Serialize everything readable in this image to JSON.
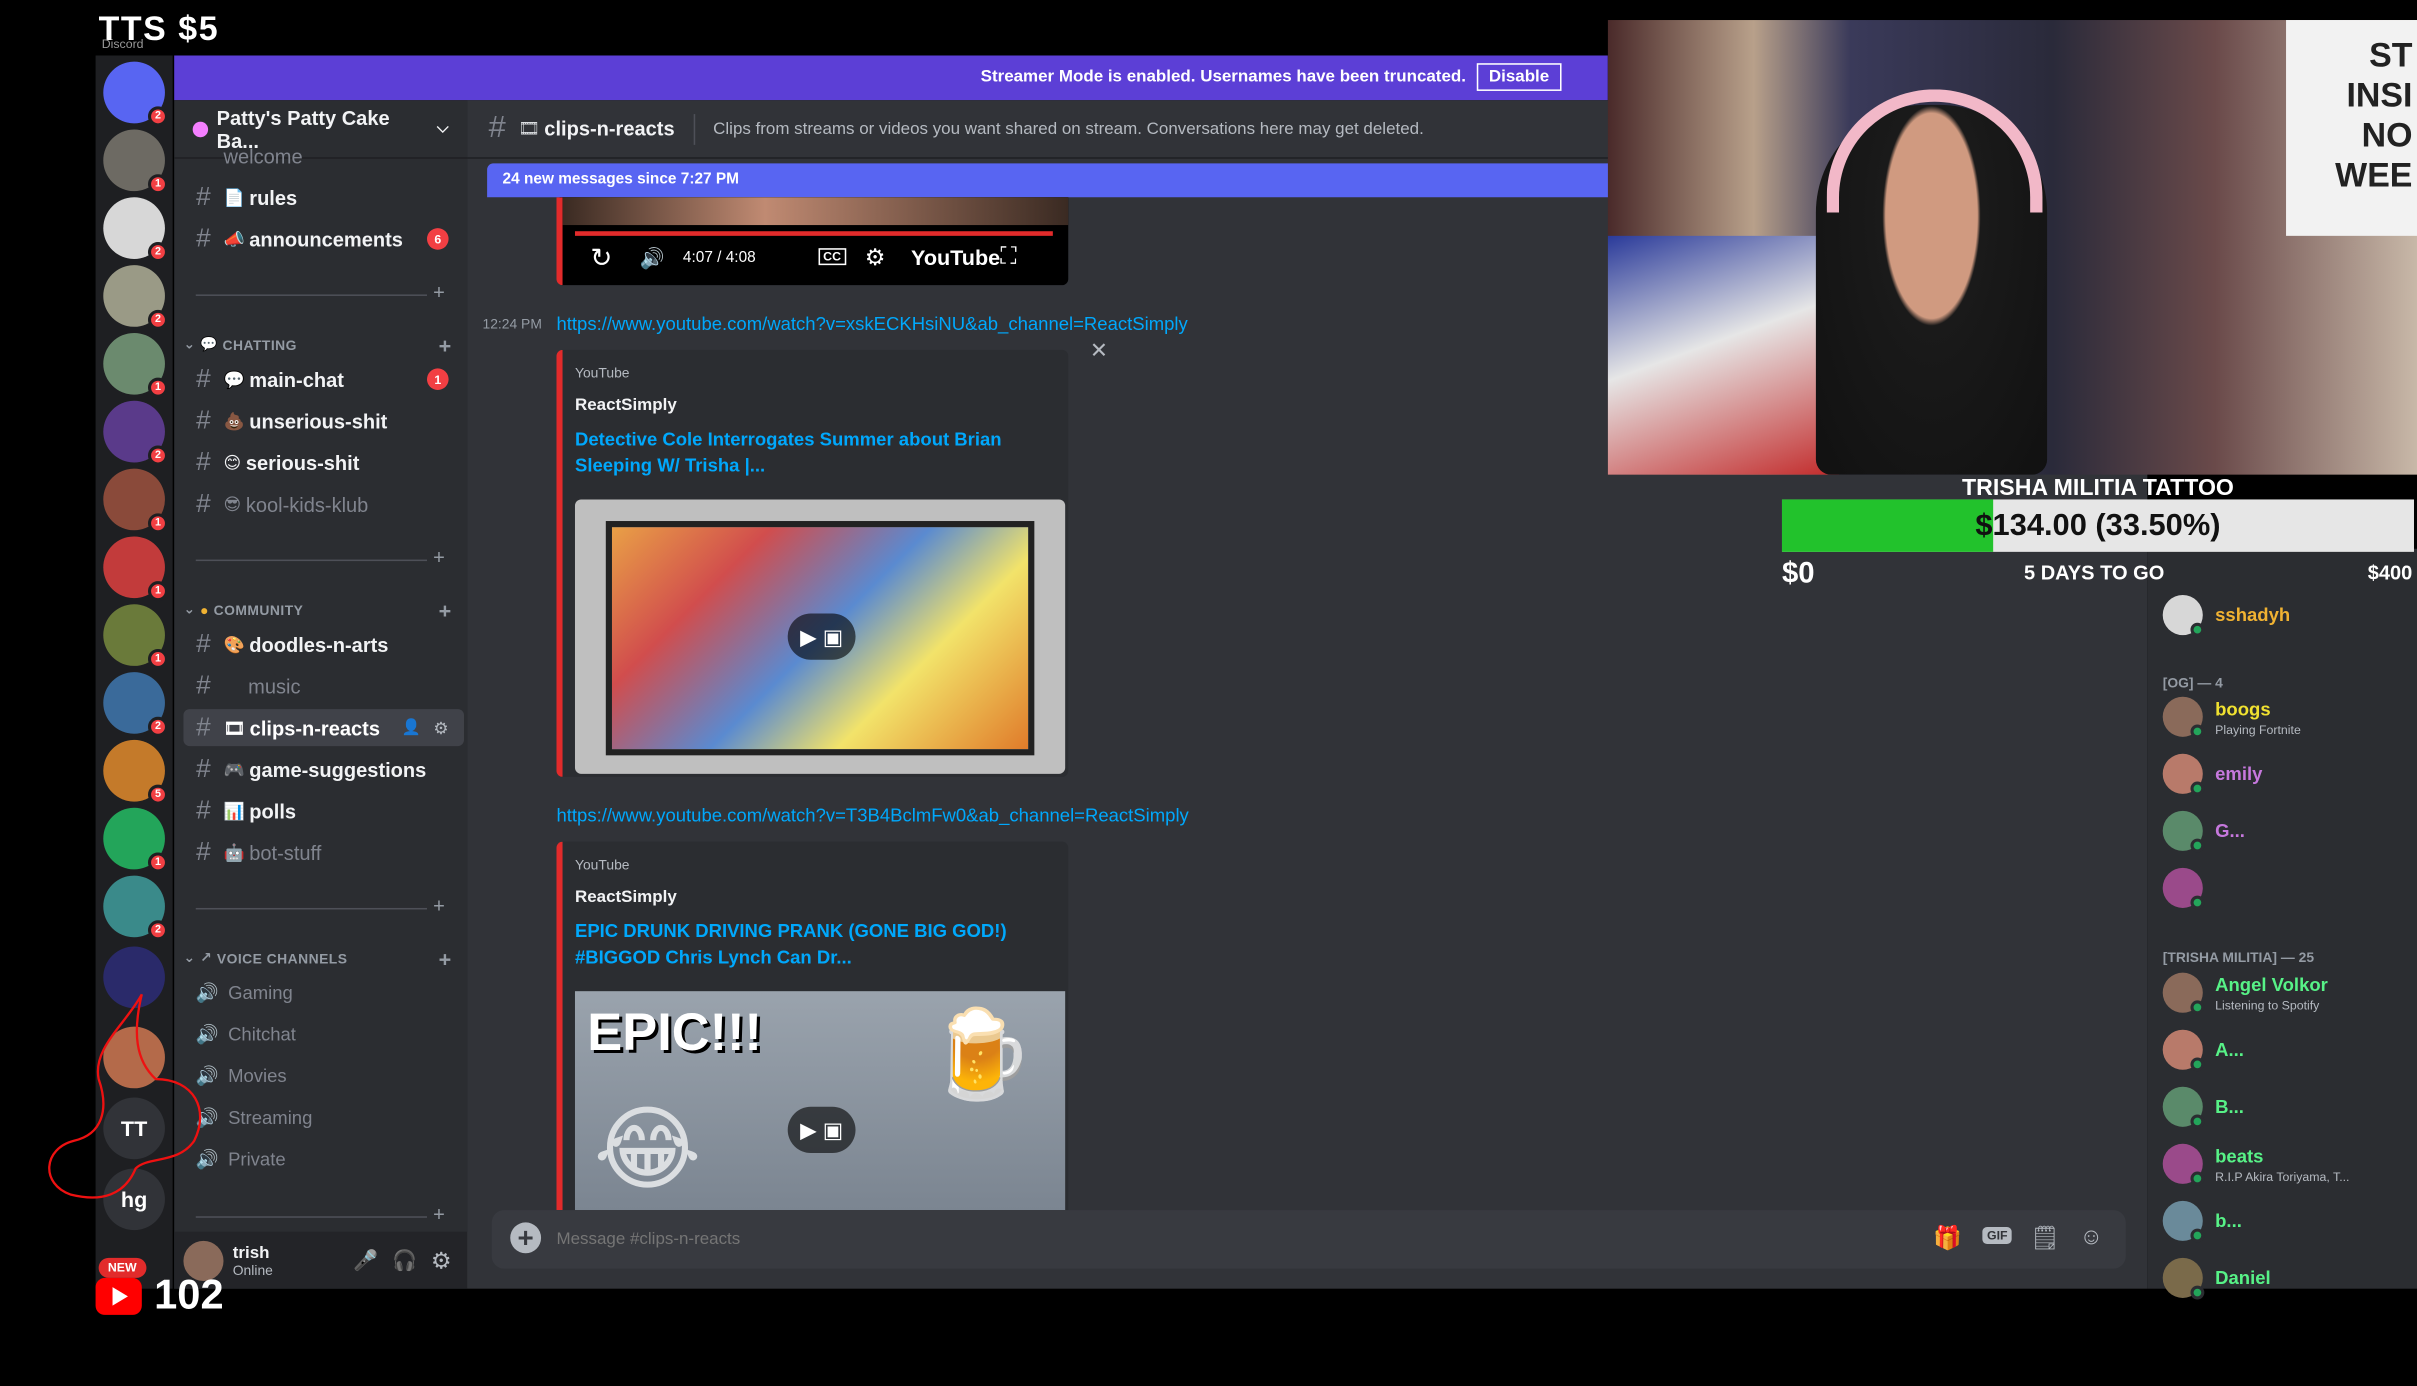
{
  "overlay": {
    "top_stat": "TTS $5",
    "discord_word": "Discord"
  },
  "banner": {
    "text": "Streamer Mode is enabled. Usernames have been truncated.",
    "button": "Disable"
  },
  "guild": {
    "name": "Patty's Patty Cake Ba..."
  },
  "rail": {
    "servers": [
      {
        "initials": "",
        "badge": "2",
        "color": "#5865f2"
      },
      {
        "initials": "",
        "badge": "1",
        "color": "#6d6a63"
      },
      {
        "initials": "",
        "badge": "2",
        "color": "#d7d7d7"
      },
      {
        "initials": "",
        "badge": "2",
        "color": "#9a9a86"
      },
      {
        "initials": "",
        "badge": "1",
        "color": "#6b8a6e"
      },
      {
        "initials": "",
        "badge": "2",
        "color": "#5a3a8a"
      },
      {
        "initials": "",
        "badge": "1",
        "color": "#8a4a3a"
      },
      {
        "initials": "",
        "badge": "1",
        "color": "#c23b3b"
      },
      {
        "initials": "",
        "badge": "1",
        "color": "#6a7a3a"
      },
      {
        "initials": "",
        "badge": "2",
        "color": "#3a6a9a"
      },
      {
        "initials": "",
        "badge": "5",
        "color": "#c47a2a"
      },
      {
        "initials": "",
        "badge": "1",
        "color": "#23a55a"
      },
      {
        "initials": "",
        "badge": "2",
        "color": "#3a8a8a"
      },
      {
        "initials": "",
        "badge": "",
        "color": "#2a2a6a"
      },
      {
        "initials": "",
        "badge": "",
        "color": "#b46a4a"
      },
      {
        "initials": "TT",
        "badge": "",
        "color": "#313338"
      },
      {
        "initials": "hg",
        "badge": "",
        "color": "#313338"
      }
    ]
  },
  "channels": {
    "top_partial": "welcome",
    "rules": "rules",
    "announcements": "announcements",
    "announcements_badge": "6",
    "cat_chatting": "CHATTING",
    "main_chat": "main-chat",
    "main_chat_badge": "1",
    "unserious": "unserious-shit",
    "serious": "serious-shit",
    "kool": "kool-kids-klub",
    "cat_community": "COMMUNITY",
    "doodles": "doodles-n-arts",
    "music": "music",
    "clips": "clips-n-reacts",
    "game": "game-suggestions",
    "polls": "polls",
    "bot": "bot-stuff",
    "cat_voice": "VOICE CHANNELS",
    "voice": [
      "Gaming",
      "Chitchat",
      "Movies",
      "Streaming",
      "Private"
    ]
  },
  "user": {
    "name": "trish",
    "status": "Online"
  },
  "chat": {
    "channel": "clips-n-reacts",
    "topic": "Clips from streams or videos you want shared on stream. Conversations here may get deleted.",
    "new_messages": "24 new messages since 7:27 PM",
    "player_time": "4:07 / 4:08",
    "player_brand": "YouTube",
    "timestamp": "12:24 PM",
    "link1": "https://www.youtube.com/watch?v=xskECKHsiNU&ab_channel=ReactSimply",
    "embed1": {
      "provider": "YouTube",
      "author": "ReactSimply",
      "title": "Detective Cole Interrogates Summer about Brian Sleeping W/ Trisha |..."
    },
    "link2": "https://www.youtube.com/watch?v=T3B4BclmFw0&ab_channel=ReactSimply",
    "embed2": {
      "provider": "YouTube",
      "author": "ReactSimply",
      "title": "EPIC DRUNK DRIVING PRANK (GONE BIG GOD!) #BIGGOD Chris Lynch Can Dr...",
      "thumb_text": "EPIC!!!"
    },
    "input_placeholder": "Message #clips-n-reacts"
  },
  "members": {
    "top": {
      "name": "sshadyh",
      "color": "#f0b232"
    },
    "cat_og": "[OG] — 4",
    "og": [
      {
        "name": "boogs",
        "sub": "Playing Fortnite",
        "color": "#f0e130"
      },
      {
        "name": "emily",
        "sub": "",
        "color": "#c678dd"
      },
      {
        "name": "G...",
        "sub": "",
        "color": "#c678dd"
      },
      {
        "name": "",
        "sub": "",
        "color": "#9b59b6"
      }
    ],
    "cat_militia": "[TRISHA MILITIA] — 25",
    "militia": [
      {
        "name": "Angel Volkor",
        "sub": "Listening to Spotify",
        "color": "#57f287"
      },
      {
        "name": "A...",
        "sub": "",
        "color": "#57f287"
      },
      {
        "name": "B...",
        "sub": "",
        "color": "#57f287"
      },
      {
        "name": "beats",
        "sub": "R.I.P Akira Toriyama, T...",
        "color": "#57f287"
      },
      {
        "name": "b...",
        "sub": "",
        "color": "#57f287"
      },
      {
        "name": "Daniel",
        "sub": "",
        "color": "#57f287"
      }
    ]
  },
  "goal": {
    "title": "TRISHA MILITIA TATTOO",
    "amount": "$134.00 (33.50%)",
    "progress_percent": 33.5,
    "start": "$0",
    "days": "5 DAYS TO GO",
    "end": "$400"
  },
  "webcam": {
    "shirt_text": "ST INSI NO WEE"
  },
  "youtube": {
    "new_label": "NEW",
    "viewers": "102"
  },
  "colors": {
    "blurple": "#5865f2",
    "banner": "#5c3fd6",
    "red": "#f23f43",
    "link": "#00a8fc",
    "green": "#22c22c"
  }
}
